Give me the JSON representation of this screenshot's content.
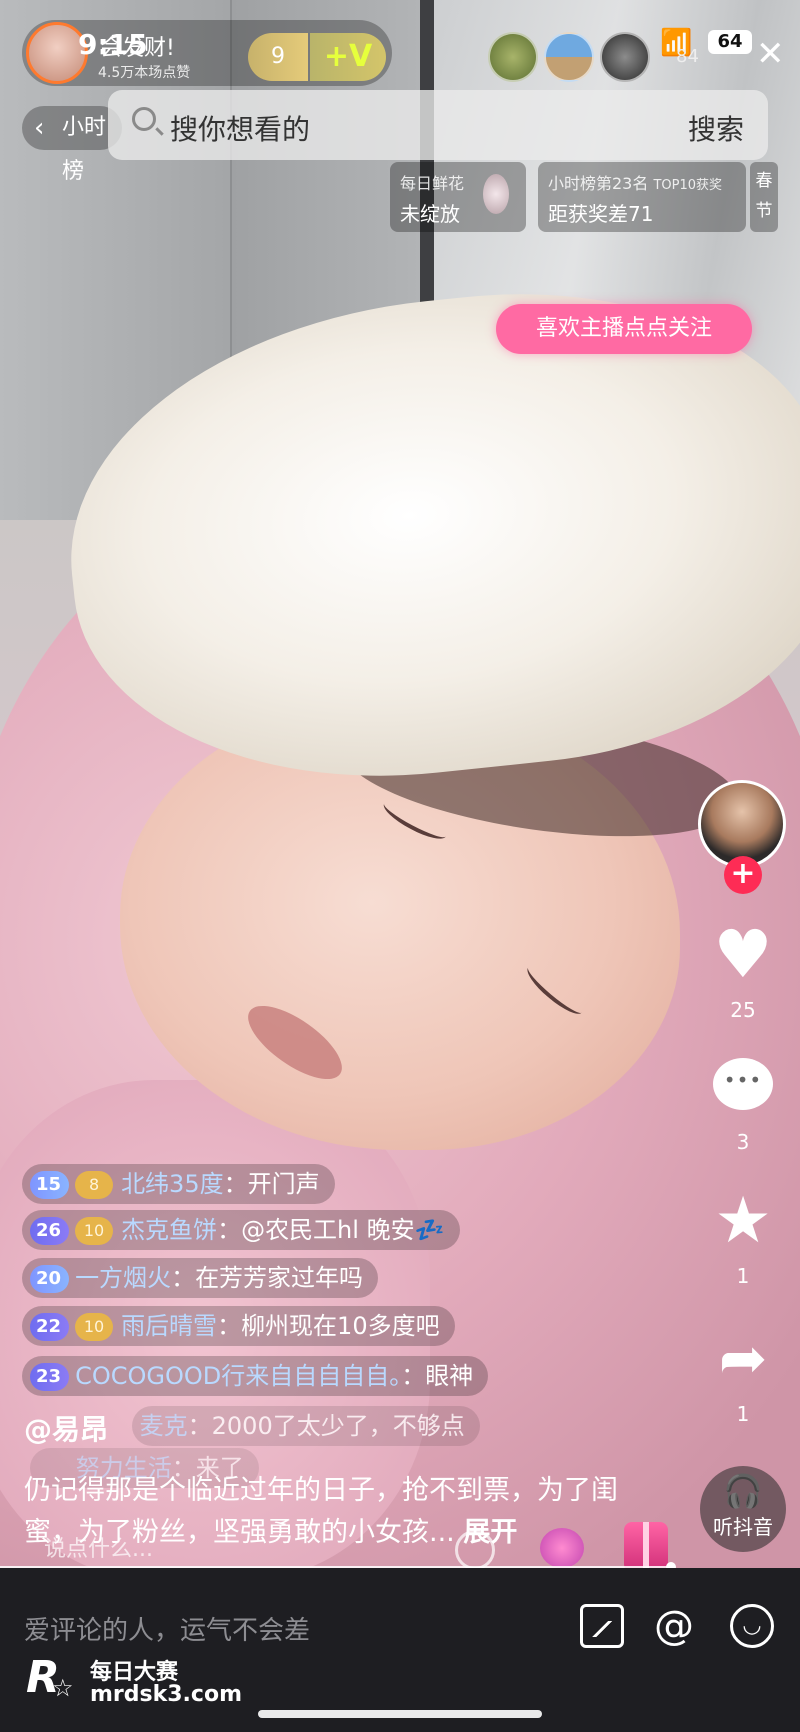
{
  "status_bar": {
    "time": "9:15",
    "battery": "64",
    "signal_number": "84"
  },
  "host": {
    "name": "会发财!",
    "likes": "4.5万本场点赞",
    "level": "9",
    "v_badge": "+V"
  },
  "header": {
    "rank_back_label": "小时榜",
    "search_placeholder": "搜你想看的",
    "search_button": "搜索"
  },
  "cards": {
    "flower": {
      "line1": "每日鲜花",
      "line2": "未绽放"
    },
    "rank": {
      "line1": "小时榜第23名",
      "line1_tag": "TOP10获奖",
      "line2": "距获奖差71"
    },
    "festival": [
      "春",
      "节"
    ]
  },
  "follow_prompt": "喜欢主播点点关注",
  "right_rail": {
    "like_count": "25",
    "comment_count": "3",
    "star_count": "1",
    "share_count": "1",
    "listen_label": "听抖音"
  },
  "chat": [
    {
      "level": "15",
      "fan": "8",
      "nick": "北纬35度",
      "msg": "开门声"
    },
    {
      "level": "26",
      "fan": "10",
      "nick": "杰克鱼饼",
      "msg": "@农民工hl 晚安💤"
    },
    {
      "level": "20",
      "fan": "",
      "nick": "一方烟火",
      "msg": "在芳芳家过年吗"
    },
    {
      "level": "22",
      "fan": "10",
      "nick": "雨后晴雪",
      "msg": "柳州现在10多度吧"
    },
    {
      "level": "23",
      "fan": "",
      "nick": "COCOGOOD行来自自自自自。",
      "msg": "眼神"
    },
    {
      "level": "",
      "fan": "",
      "nick": "麦克",
      "msg": "2000了太少了，不够点"
    },
    {
      "level": "",
      "fan": "",
      "nick": "努力生活",
      "msg": "来了"
    }
  ],
  "caption": {
    "user": "@易昂",
    "text": "仍记得那是个临近过年的日子，抢不到票，为了闺蜜，为了粉丝，坚强勇敢的小女孩...",
    "more": "展开"
  },
  "input": {
    "placeholder": "说点什么..."
  },
  "comment_bar": {
    "placeholder": "爱评论的人，运气不会差"
  },
  "watermark": {
    "logo": "R",
    "title": "每日大赛",
    "url": "mrdsk3.com"
  },
  "icons": [
    "back-chevron-icon",
    "search-icon",
    "close-icon",
    "wifi-icon",
    "heart-icon",
    "comment-icon",
    "star-icon",
    "share-icon",
    "headphones-icon",
    "image-icon",
    "at-icon",
    "emoji-icon"
  ],
  "colors": {
    "accent": "#fe2c55",
    "follow_bubble": "#ff6aa3",
    "level_badge": "#7b74f3",
    "bottom_bar": "#1e1e22"
  }
}
